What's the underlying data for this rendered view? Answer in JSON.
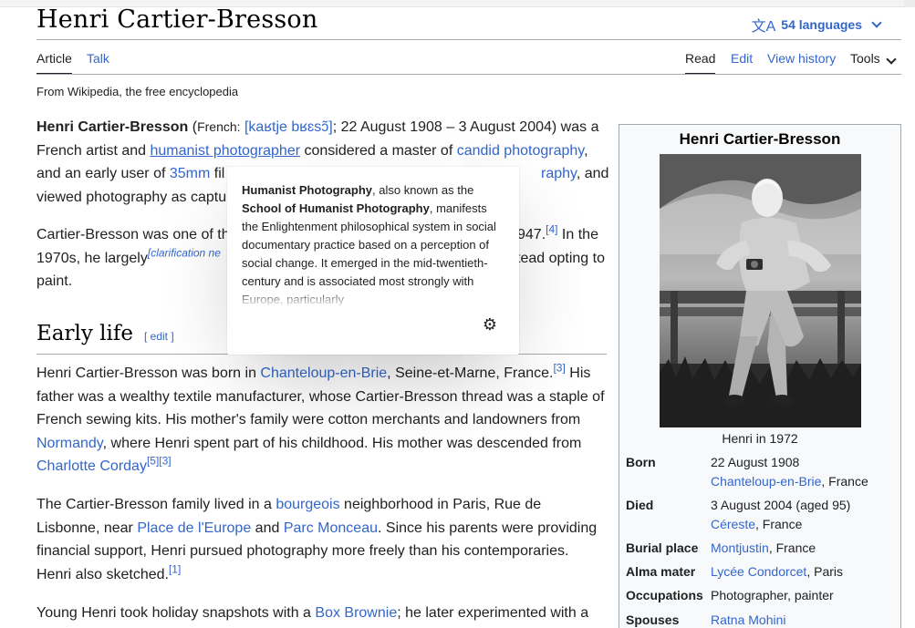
{
  "page": {
    "title": "Henri Cartier-Bresson",
    "languages_label": "54 languages",
    "tagline": "From Wikipedia, the free encyclopedia"
  },
  "tabs": {
    "article": "Article",
    "talk": "Talk",
    "read": "Read",
    "edit": "Edit",
    "view_history": "View history",
    "tools": "Tools"
  },
  "intro": {
    "p1": {
      "name": "Henri Cartier-Bresson",
      "open_paren": " (",
      "french": "French:",
      "ipa": "[kaʁtje bʁɛsɔ̃]",
      "dates": "; 22 August 1908 – 3 August 2004) was a",
      "line2_a": "French artist and ",
      "link_humanist": "humanist photographer",
      "line2_b": " considered a master of ",
      "link_candid": "candid photography",
      "line2_c": ",",
      "line3_a": "and an early user of ",
      "link_35mm": "35mm",
      "line3_b": " fil",
      "line3_hidden_link": "raphy",
      "line3_c": ", and",
      "line4": "viewed photography as captu"
    },
    "p2": {
      "line1_a": "Cartier-Bresson was one of th",
      "line1_b": "947.",
      "ref4": "[4]",
      "line1_c": " In the",
      "line2_a": "1970s, he largely",
      "clarification": "[clarification ne",
      "line2_b": "tead opting to",
      "line3": "paint."
    }
  },
  "section": {
    "heading": "Early life",
    "edit_label": "[ edit ]"
  },
  "early_life": {
    "p1": {
      "a": "Henri Cartier-Bresson was born in ",
      "link_chanteloup": "Chanteloup-en-Brie",
      "b": ", Seine-et-Marne, France.",
      "ref3": "[3]",
      "c": " His father was a wealthy textile manufacturer, whose Cartier-Bresson thread was a staple of French sewing kits. His mother's family were cotton merchants and landowners from ",
      "link_normandy": "Normandy",
      "d": ", where Henri spent part of his childhood. His mother was descended from ",
      "link_corday": "Charlotte Corday",
      "ref53": "[5][3]"
    },
    "p2": {
      "a": "The Cartier-Bresson family lived in a ",
      "link_bourgeois": "bourgeois",
      "b": " neighborhood in Paris, Rue de Lisbonne, near ",
      "link_europe": "Place de l'Europe",
      "c": " and ",
      "link_monceau": "Parc Monceau",
      "d": ". Since his parents were providing financial support, Henri pursued photography more freely than his contemporaries. Henri also sketched.",
      "ref1": "[1]"
    },
    "p3": {
      "a": "Young Henri took holiday snapshots with a ",
      "link_brownie": "Box Brownie",
      "b": "; he later experimented with a"
    }
  },
  "infobox": {
    "title": "Henri Cartier-Bresson",
    "caption": "Henri in 1972",
    "born_label": "Born",
    "born_date": "22 August 1908",
    "born_place_link": "Chanteloup-en-Brie",
    "born_place_rest": ", France",
    "died_label": "Died",
    "died_date": "3 August 2004 (aged 95)",
    "died_place_link": "Céreste",
    "died_place_rest": ", France",
    "burial_label": "Burial place",
    "burial_link": "Montjustin",
    "burial_rest": ", France",
    "alma_label": "Alma mater",
    "alma_link": "Lycée Condorcet",
    "alma_rest": ", Paris",
    "occupations_label": "Occupations",
    "occupations_value": "Photographer, painter",
    "spouses_label": "Spouses",
    "spouses_link": "Ratna Mohini"
  },
  "popup": {
    "bold1": "Humanist Photography",
    "text1": ", also known as the ",
    "bold2": "School of Humanist Photography",
    "text2": ", manifests the Enlightenment philosophical system in social documentary practice based on a perception of social change. It emerged in the mid-twentieth-century and is associated most strongly with Europe, particularly",
    "settings_icon": "gear-icon"
  },
  "colors": {
    "link": "#3366cc",
    "text": "#202122",
    "border": "#a2a9b1",
    "infobox_bg": "#f8f9fa"
  }
}
